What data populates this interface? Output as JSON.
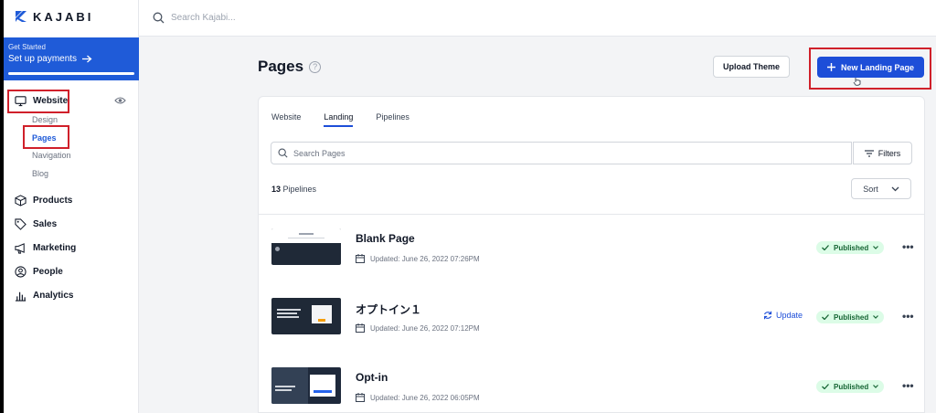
{
  "brand": {
    "name": "KAJABI",
    "accent": "#1d4ed8"
  },
  "topbar": {
    "search_placeholder": "Search Kajabi..."
  },
  "get_started": {
    "title": "Get Started",
    "subtitle": "Set up payments",
    "progress": 1.0
  },
  "sidebar": {
    "website_label": "Website",
    "sub_items": [
      {
        "label": "Design",
        "active": false
      },
      {
        "label": "Pages",
        "active": true
      },
      {
        "label": "Navigation",
        "active": false
      },
      {
        "label": "Blog",
        "active": false
      }
    ],
    "items": [
      {
        "label": "Products",
        "icon": "box-icon"
      },
      {
        "label": "Sales",
        "icon": "tag-icon"
      },
      {
        "label": "Marketing",
        "icon": "megaphone-icon"
      },
      {
        "label": "People",
        "icon": "person-icon"
      },
      {
        "label": "Analytics",
        "icon": "bar-chart-icon"
      }
    ]
  },
  "header": {
    "title": "Pages",
    "help_glyph": "?",
    "upload_label": "Upload Theme",
    "new_label": "New Landing Page"
  },
  "tabs": [
    {
      "label": "Website",
      "active": false
    },
    {
      "label": "Landing",
      "active": true
    },
    {
      "label": "Pipelines",
      "active": false
    }
  ],
  "search": {
    "placeholder": "Search Pages"
  },
  "filters_label": "Filters",
  "count": {
    "number": "13",
    "label": "Pipelines"
  },
  "sort_label": "Sort",
  "rows": [
    {
      "title": "Blank Page",
      "date": "Updated: June 26, 2022 07:26PM",
      "status": "Published",
      "update": ""
    },
    {
      "title": "オプトイン１",
      "date": "Updated: June 26, 2022 07:12PM",
      "status": "Published",
      "update": "Update"
    },
    {
      "title": "Opt-in",
      "date": "Updated: June 26, 2022 06:05PM",
      "status": "Published",
      "update": ""
    }
  ]
}
